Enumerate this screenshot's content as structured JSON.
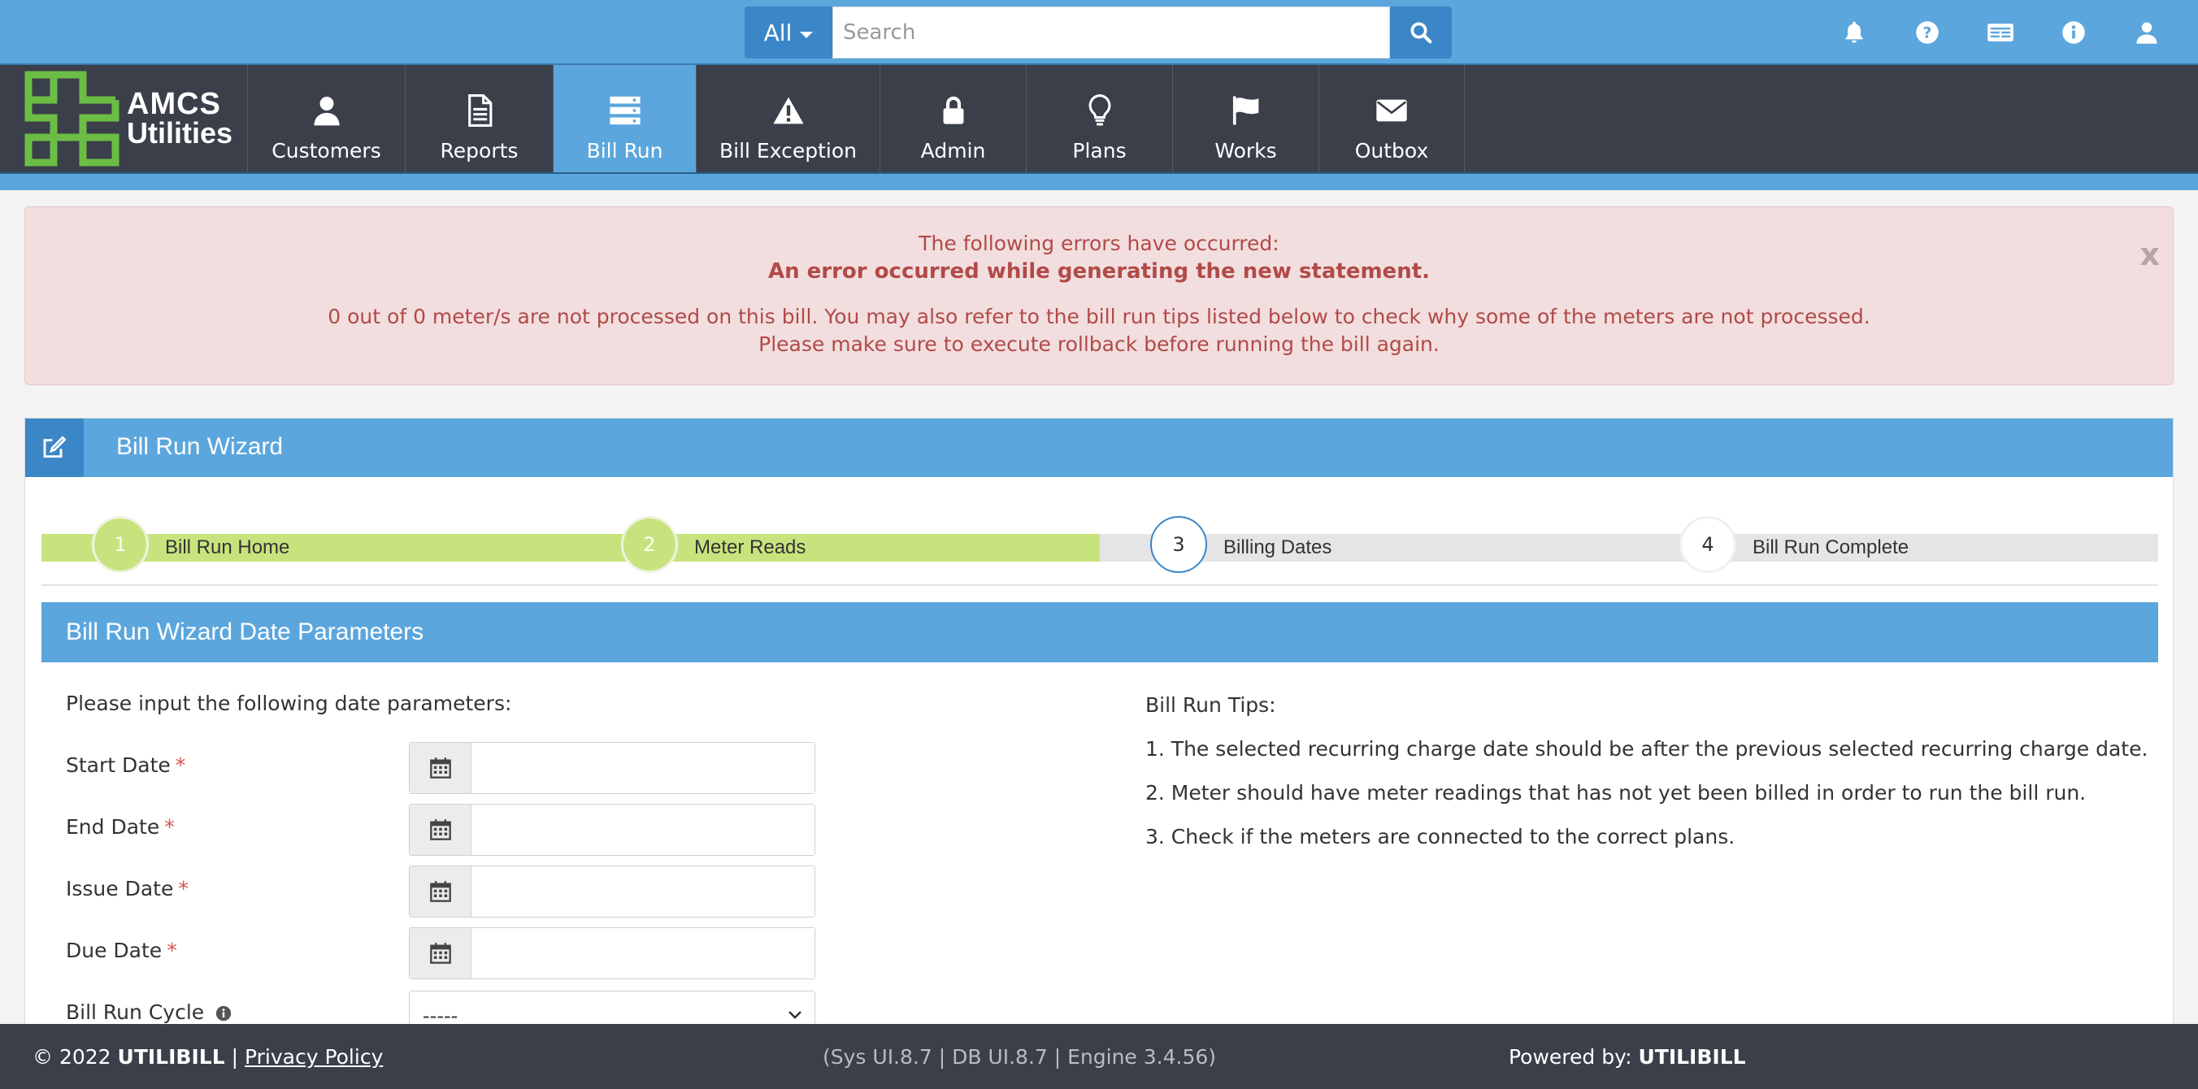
{
  "topbar": {
    "search_scope": "All",
    "search_placeholder": "Search",
    "icons": [
      "bell-icon",
      "question-icon",
      "id-card-icon",
      "info-icon",
      "user-icon"
    ]
  },
  "brand": {
    "line1": "AMCS",
    "line2": "Utilities",
    "logo_color": "#6cbd45"
  },
  "nav": {
    "items": [
      {
        "label": "Customers",
        "icon": "user-icon"
      },
      {
        "label": "Reports",
        "icon": "document-icon"
      },
      {
        "label": "Bill Run",
        "icon": "server-icon",
        "active": true
      },
      {
        "label": "Bill Exception",
        "icon": "warning-icon"
      },
      {
        "label": "Admin",
        "icon": "lock-icon"
      },
      {
        "label": "Plans",
        "icon": "lightbulb-icon"
      },
      {
        "label": "Works",
        "icon": "flag-icon"
      },
      {
        "label": "Outbox",
        "icon": "envelope-icon"
      }
    ]
  },
  "alert": {
    "line1": "The following errors have occurred:",
    "line2": "An error occurred while generating the new statement.",
    "line3": "0 out of 0 meter/s are not processed on this bill. You may also refer to the bill run tips listed below to check why some of the meters are not processed.",
    "line4": "Please make sure to execute rollback before running the bill again.",
    "close": "x"
  },
  "wizard": {
    "title": "Bill Run Wizard",
    "steps": [
      {
        "number": "1",
        "label": "Bill Run Home",
        "status": "done"
      },
      {
        "number": "2",
        "label": "Meter Reads",
        "status": "done"
      },
      {
        "number": "3",
        "label": "Billing Dates",
        "status": "current"
      },
      {
        "number": "4",
        "label": "Bill Run Complete",
        "status": "pending"
      }
    ],
    "section_title": "Bill Run Wizard Date Parameters",
    "instructions": "Please input the following date parameters:",
    "fields": {
      "start": {
        "label": "Start Date",
        "value": ""
      },
      "end": {
        "label": "End Date",
        "value": ""
      },
      "issue": {
        "label": "Issue Date",
        "value": ""
      },
      "due": {
        "label": "Due Date",
        "value": ""
      }
    },
    "required_mark": "*",
    "cycle": {
      "label": "Bill Run Cycle",
      "selected": "-----"
    },
    "tips": {
      "heading": "Bill Run Tips:",
      "items": [
        "1. The selected recurring charge date should be after the previous selected recurring charge date.",
        "2. Meter should have meter readings that has not yet been billed in order to run the bill run.",
        "3. Check if the meters are connected to the correct plans."
      ]
    }
  },
  "footer": {
    "copyright": "© 2022",
    "brand": "UTILIBILL",
    "separator": "|",
    "privacy": "Privacy Policy",
    "versions": "(Sys UI.8.7 | DB UI.8.7 | Engine 3.4.56)",
    "powered_label": "Powered by:",
    "powered_brand": "UTILIBILL"
  },
  "colors": {
    "primary": "#5ba6dd",
    "primary_dark": "#3b86c6",
    "nav_bg": "#3a3f4a",
    "alert_bg": "#f2dede",
    "alert_text": "#b14a48",
    "step_done": "#c8e37d",
    "required": "#d9534f"
  }
}
